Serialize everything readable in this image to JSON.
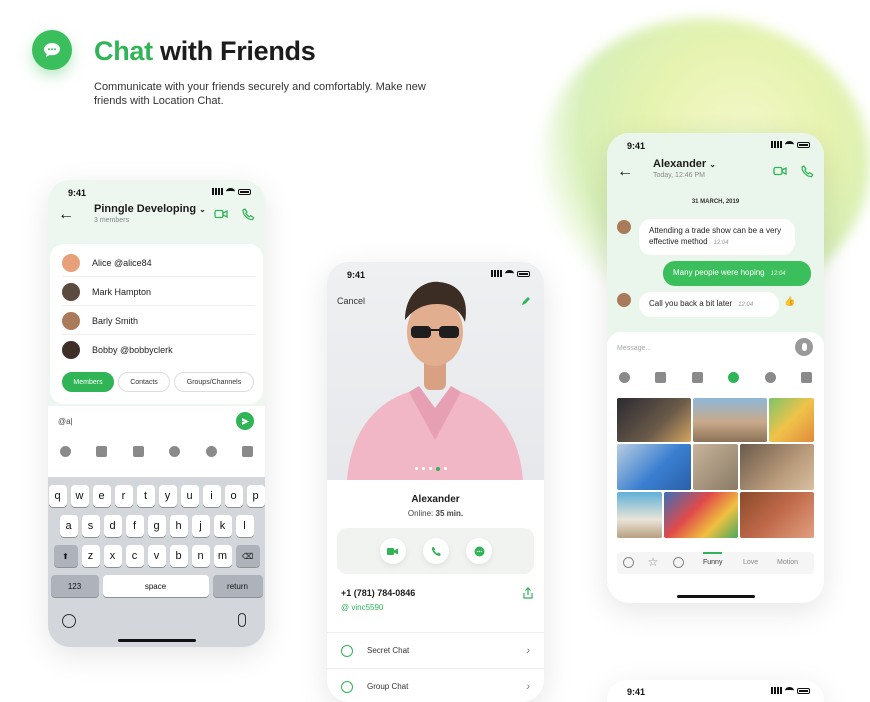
{
  "hero": {
    "title_accent": "Chat",
    "title_rest": " with Friends",
    "subtitle": "Communicate with your friends securely and comfortably. Make new friends with Location Chat."
  },
  "colors": {
    "accent": "#2fb556",
    "accent_light": "#3bbf5c",
    "bg_soft": "#edf7ef"
  },
  "status_time": "9:41",
  "group_chat": {
    "title": "Pinngle Developing",
    "subtitle": "3 members",
    "members": [
      {
        "name": "Alice @alice84",
        "color": "#e8a07a"
      },
      {
        "name": "Mark Hampton",
        "color": "#5a4a3f"
      },
      {
        "name": "Barly Smith",
        "color": "#a97b5b"
      },
      {
        "name": "Bobby @bobbyclerk",
        "color": "#3f2f28"
      }
    ],
    "tabs": [
      "Members",
      "Contacts",
      "Groups/Channels"
    ],
    "input_value": "@a|",
    "keyboard": {
      "row1": [
        "q",
        "w",
        "e",
        "r",
        "t",
        "y",
        "u",
        "i",
        "o",
        "p"
      ],
      "row2": [
        "a",
        "s",
        "d",
        "f",
        "g",
        "h",
        "j",
        "k",
        "l"
      ],
      "row3": [
        "z",
        "x",
        "c",
        "v",
        "b",
        "n",
        "m"
      ],
      "num_key": "123",
      "space_key": "space",
      "return_key": "return"
    }
  },
  "profile": {
    "cancel": "Cancel",
    "name": "Alexander",
    "online_label": "Online:",
    "online_value": "35 min.",
    "phone": "+1 (781) 784-0846",
    "username": "@ vinc5590",
    "menu": [
      "Secret Chat",
      "Group Chat"
    ]
  },
  "direct_chat": {
    "title": "Alexander",
    "subtitle": "Today, 12:46 PM",
    "date": "31 MARCH, 2019",
    "messages": [
      {
        "text": "Attending a trade show can be a very effective method",
        "time": "12:04",
        "dir": "in"
      },
      {
        "text": "Many people were hoping",
        "time": "12:04",
        "dir": "out"
      },
      {
        "text": "Call you back a bit later",
        "time": "12:04",
        "dir": "in"
      }
    ],
    "placeholder": "Message...",
    "gif_tabs": [
      "Funny",
      "Love",
      "Motion"
    ]
  }
}
